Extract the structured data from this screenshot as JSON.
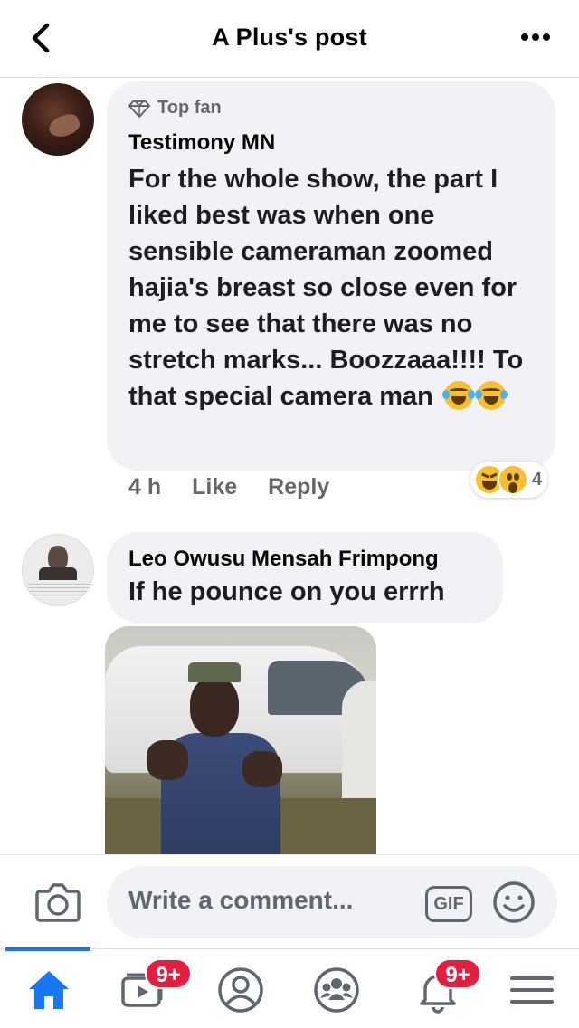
{
  "header": {
    "title": "A Plus's post"
  },
  "comments": [
    {
      "badge": "Top fan",
      "author": "Testimony MN",
      "text": "For the whole show, the part I liked best was when one sensible cameraman zoomed hajia's breast so close even for me to see that there was no stretch marks... Boozzaaa!!!! To that special camera man",
      "trailing_emoji": [
        "joy-emoji",
        "joy-emoji"
      ],
      "time": "4 h",
      "like_label": "Like",
      "reply_label": "Reply",
      "reactions": [
        "haha",
        "wow"
      ],
      "reaction_count": "4"
    },
    {
      "author": "Leo Owusu Mensah Frimpong",
      "text": "If he pounce on you errrh",
      "attachment": "photo"
    }
  ],
  "composer": {
    "placeholder": "Write a comment...",
    "gif_label": "GIF"
  },
  "nav": {
    "items": [
      {
        "name": "home",
        "active": true
      },
      {
        "name": "watch",
        "badge": "9+"
      },
      {
        "name": "profile"
      },
      {
        "name": "groups"
      },
      {
        "name": "notifications",
        "badge": "9+"
      },
      {
        "name": "menu"
      }
    ]
  },
  "colors": {
    "accent": "#1877f2",
    "bubble": "#f0f2f5",
    "badge": "#e41e3f",
    "muted": "#65676b"
  }
}
